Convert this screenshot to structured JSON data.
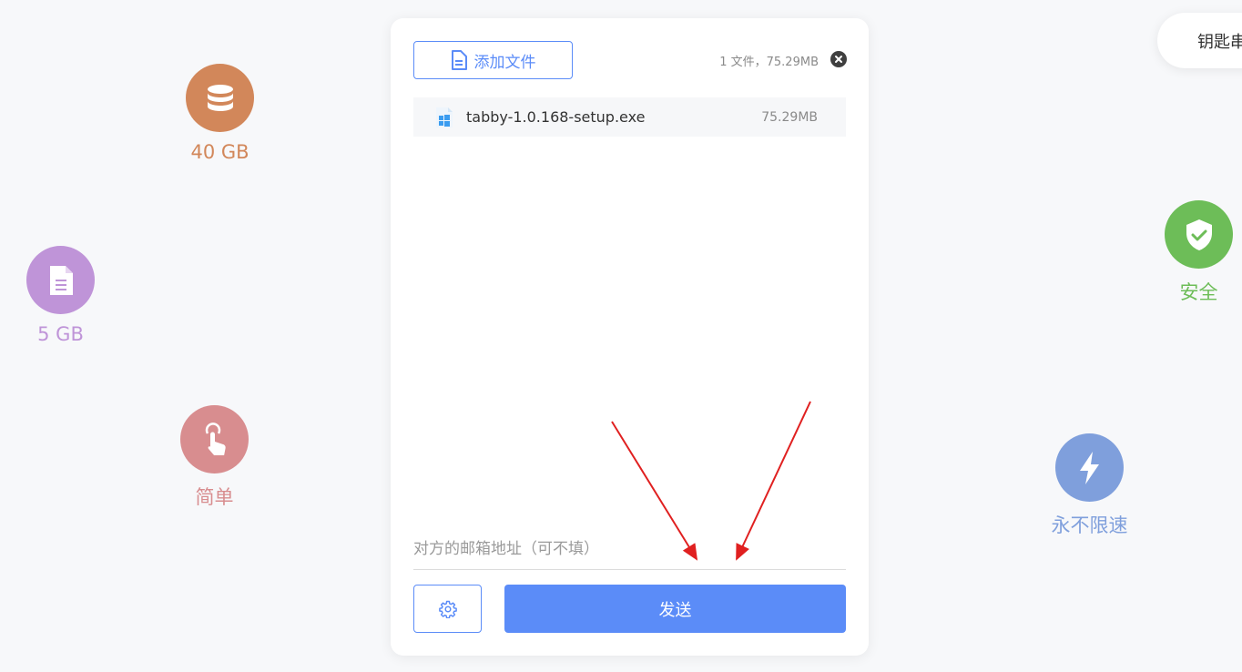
{
  "features": {
    "storage_40": {
      "label": "40 GB",
      "icon": "database-icon",
      "color": "#d2875a"
    },
    "storage_5": {
      "label": "5 GB",
      "icon": "file-icon",
      "color": "#bf94d8"
    },
    "simple": {
      "label": "简单",
      "icon": "pointer-hand-icon",
      "color": "#d88d8f"
    },
    "secure": {
      "label": "安全",
      "icon": "shield-check-icon",
      "color": "#6dbd58"
    },
    "speed": {
      "label": "永不限速",
      "icon": "lightning-icon",
      "color": "#7f9fdc"
    }
  },
  "top_right": {
    "label": "钥匙串"
  },
  "panel": {
    "add_files_label": "添加文件",
    "summary": "1 文件，75.29MB",
    "files": [
      {
        "name": "tabby-1.0.168-setup.exe",
        "size": "75.29MB",
        "icon": "windows-file-icon"
      }
    ],
    "email_placeholder": "对方的邮箱地址（可不填）",
    "email_value": "",
    "send_label": "发送",
    "settings_icon": "gear-icon"
  },
  "annotation_color": "#e02020"
}
